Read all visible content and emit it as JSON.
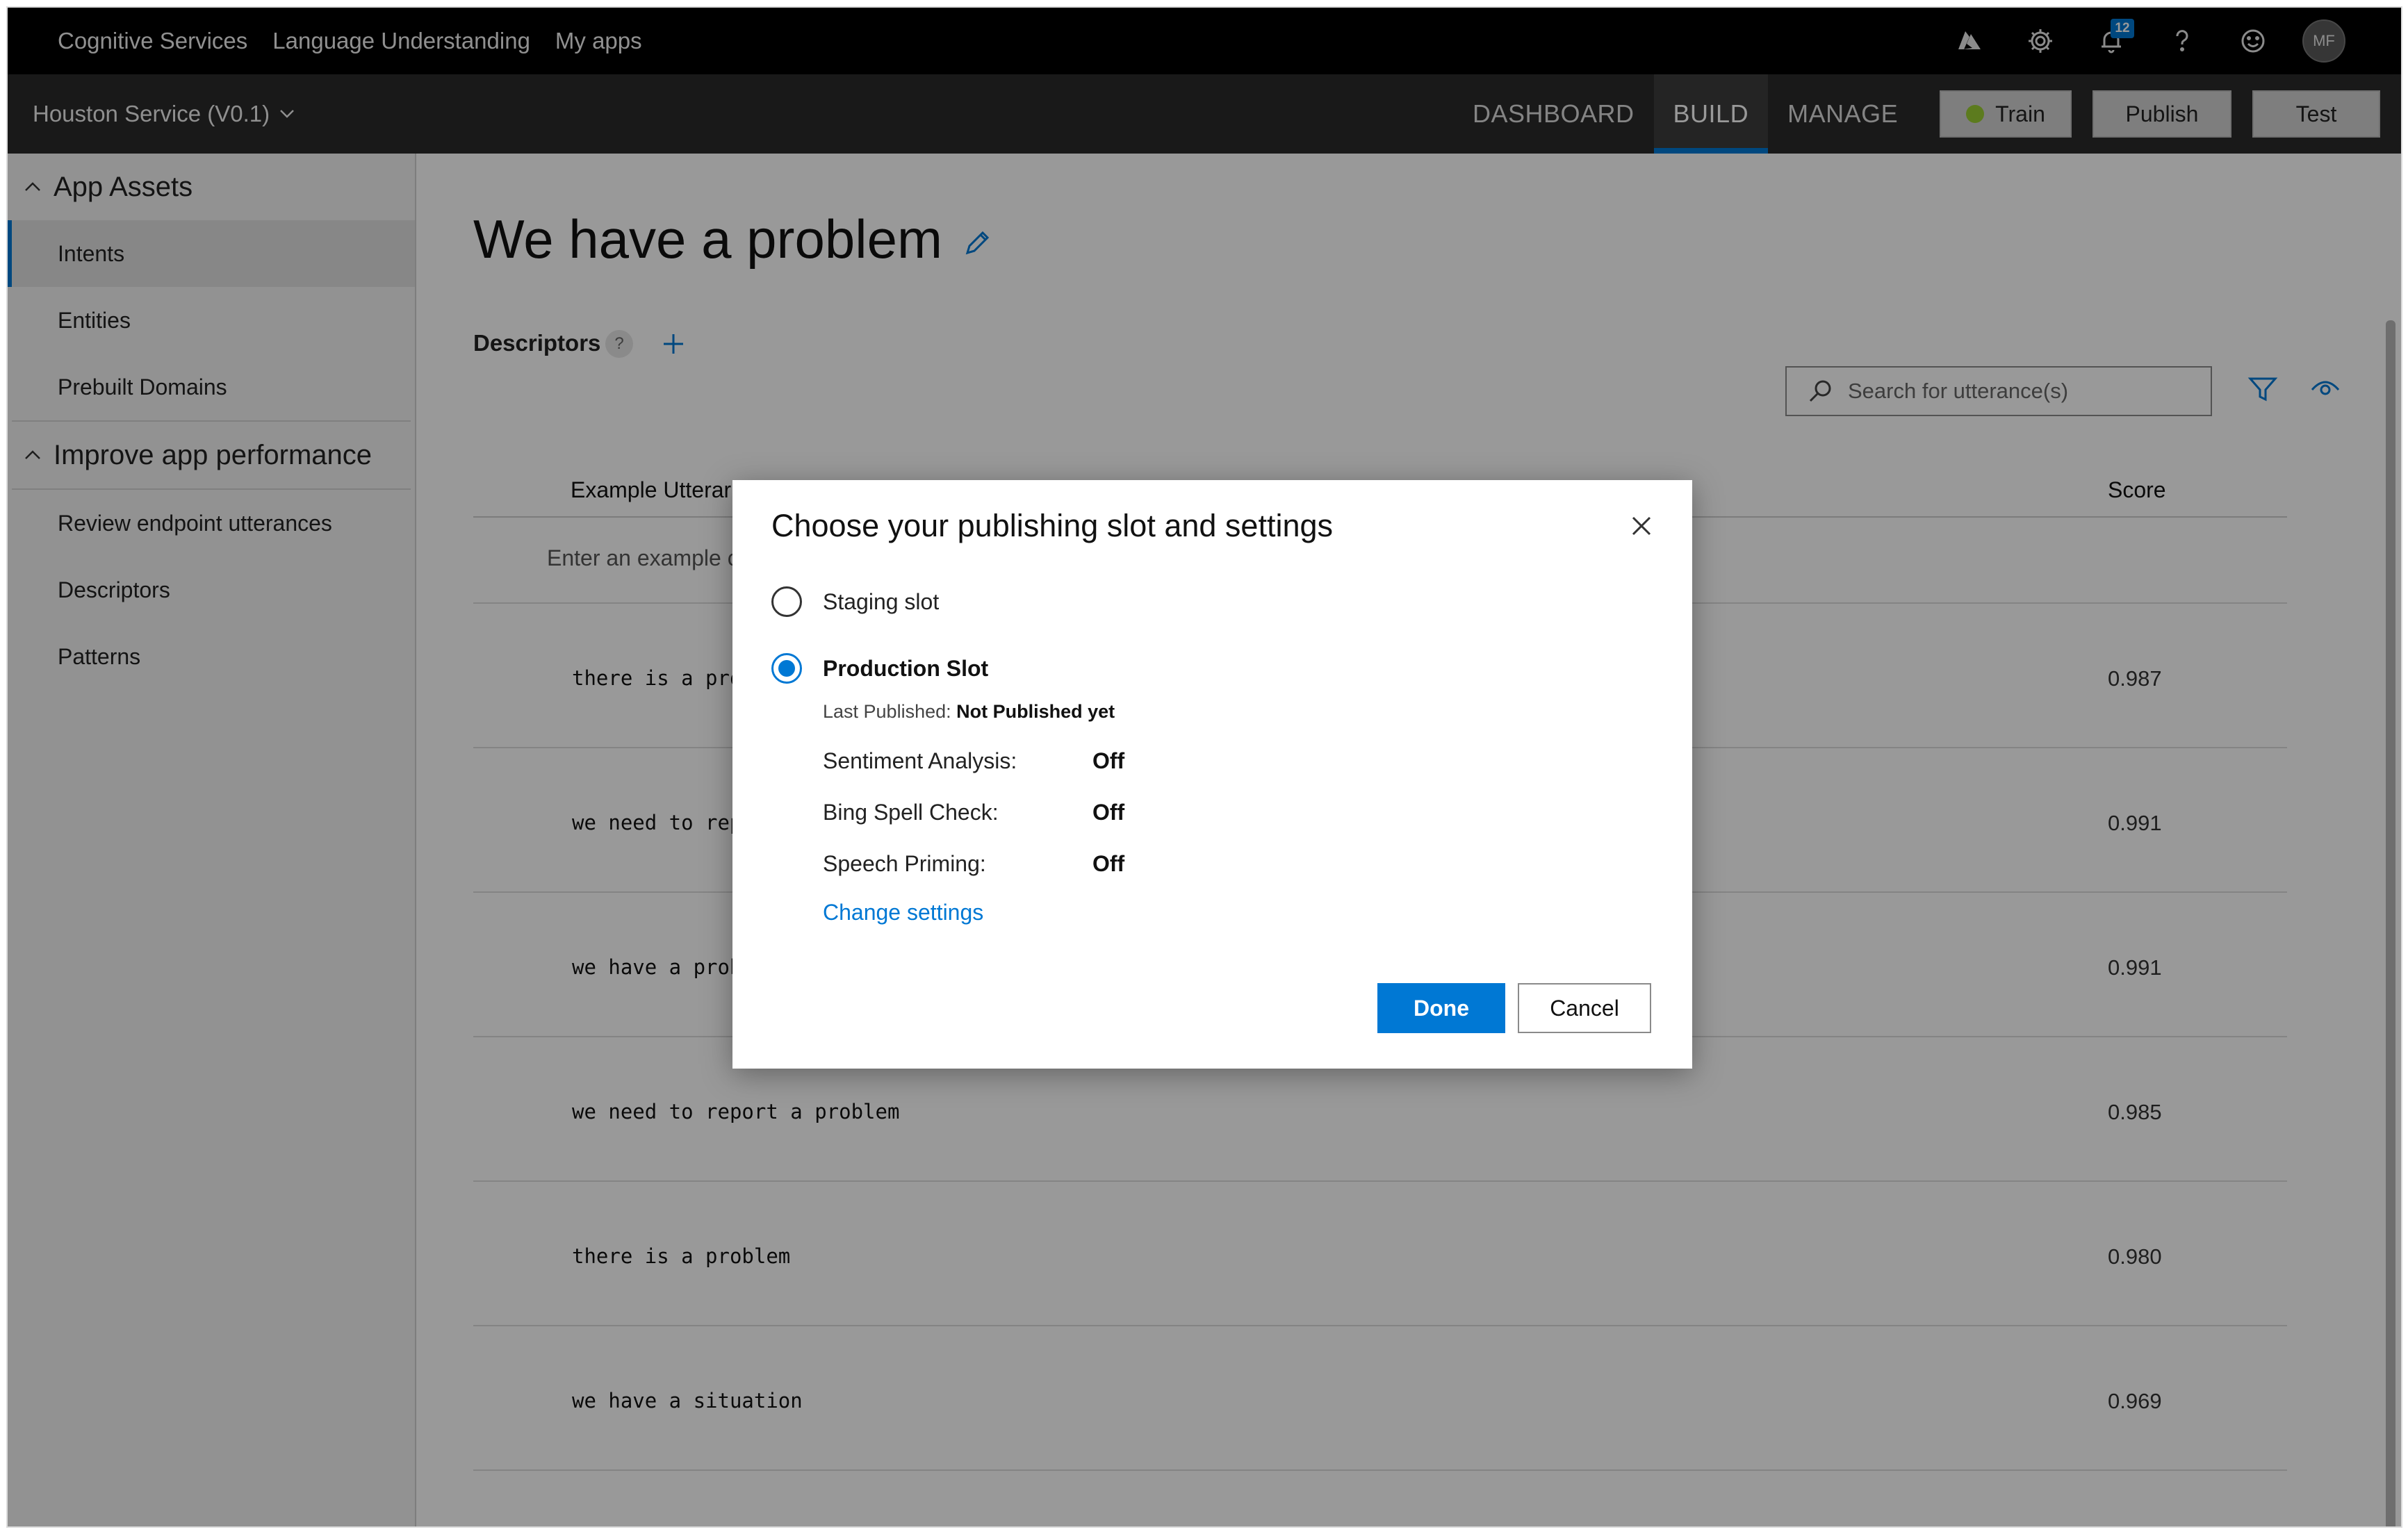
{
  "topbar": {
    "crumbs": [
      "Cognitive Services",
      "Language Understanding",
      "My apps"
    ],
    "icons": [
      "azure-icon",
      "gear-icon",
      "bell-icon",
      "help-icon",
      "smiley-icon"
    ],
    "notification_count": "12",
    "avatar_initials": "MF"
  },
  "appbar": {
    "app_name": "Houston Service (V0.1)",
    "tabs": [
      "DASHBOARD",
      "BUILD",
      "MANAGE"
    ],
    "active_tab": "BUILD",
    "train_label": "Train",
    "publish_label": "Publish",
    "test_label": "Test",
    "train_status_color": "#9acd32",
    "accent_color": "#0078d4"
  },
  "sidebar": {
    "sections": [
      {
        "heading": "App Assets",
        "items": [
          "Intents",
          "Entities",
          "Prebuilt Domains"
        ]
      },
      {
        "heading": "Improve app performance",
        "items": [
          "Review endpoint utterances",
          "Descriptors",
          "Patterns"
        ]
      }
    ],
    "active_item": "Intents"
  },
  "main": {
    "title": "We have a problem",
    "descriptors_label": "Descriptors",
    "help_glyph": "?",
    "search_placeholder": "Search for utterance(s)",
    "table": {
      "col_utterance": "Example Utterar",
      "col_score": "Score",
      "enter_placeholder": "Enter an example c",
      "rows": [
        {
          "utterance": "there is a prob",
          "score": "0.987"
        },
        {
          "utterance": "we need to repc",
          "score": "0.991"
        },
        {
          "utterance": "we have a probl",
          "score": "0.991"
        },
        {
          "utterance": "we need to report a problem",
          "score": "0.985"
        },
        {
          "utterance": "there is a problem",
          "score": "0.980"
        },
        {
          "utterance": "we have a situation",
          "score": "0.969"
        }
      ]
    }
  },
  "dialog": {
    "title": "Choose your publishing slot and settings",
    "staging_label": "Staging slot",
    "production_label": "Production Slot",
    "selected_slot": "Production Slot",
    "last_published_label": "Last Published:",
    "last_published_value": "Not Published yet",
    "settings": [
      {
        "label": "Sentiment Analysis:",
        "value": "Off"
      },
      {
        "label": "Bing Spell Check:",
        "value": "Off"
      },
      {
        "label": "Speech Priming:",
        "value": "Off"
      }
    ],
    "change_settings_label": "Change settings",
    "done_label": "Done",
    "cancel_label": "Cancel"
  }
}
